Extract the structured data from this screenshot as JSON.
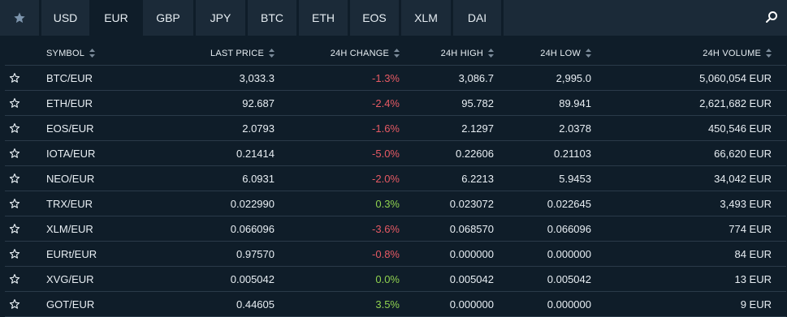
{
  "tabs": {
    "favorites_icon": "star-icon",
    "items": [
      "USD",
      "EUR",
      "GBP",
      "JPY",
      "BTC",
      "ETH",
      "EOS",
      "XLM",
      "DAI"
    ],
    "active": "EUR",
    "search_icon": "search-icon"
  },
  "table": {
    "headers": {
      "symbol": "SYMBOL",
      "last_price": "LAST PRICE",
      "change_24h": "24H CHANGE",
      "high_24h": "24H HIGH",
      "low_24h": "24H LOW",
      "volume_24h": "24H VOLUME"
    },
    "rows": [
      {
        "symbol": "BTC/EUR",
        "last": "3,033.3",
        "change": "-1.3%",
        "high": "3,086.7",
        "low": "2,995.0",
        "volume": "5,060,054 EUR"
      },
      {
        "symbol": "ETH/EUR",
        "last": "92.687",
        "change": "-2.4%",
        "high": "95.782",
        "low": "89.941",
        "volume": "2,621,682 EUR"
      },
      {
        "symbol": "EOS/EUR",
        "last": "2.0793",
        "change": "-1.6%",
        "high": "2.1297",
        "low": "2.0378",
        "volume": "450,546 EUR"
      },
      {
        "symbol": "IOTA/EUR",
        "last": "0.21414",
        "change": "-5.0%",
        "high": "0.22606",
        "low": "0.21103",
        "volume": "66,620 EUR"
      },
      {
        "symbol": "NEO/EUR",
        "last": "6.0931",
        "change": "-2.0%",
        "high": "6.2213",
        "low": "5.9453",
        "volume": "34,042 EUR"
      },
      {
        "symbol": "TRX/EUR",
        "last": "0.022990",
        "change": "0.3%",
        "high": "0.023072",
        "low": "0.022645",
        "volume": "3,493 EUR"
      },
      {
        "symbol": "XLM/EUR",
        "last": "0.066096",
        "change": "-3.6%",
        "high": "0.068570",
        "low": "0.066096",
        "volume": "774 EUR"
      },
      {
        "symbol": "EURt/EUR",
        "last": "0.97570",
        "change": "-0.8%",
        "high": "0.000000",
        "low": "0.000000",
        "volume": "84 EUR"
      },
      {
        "symbol": "XVG/EUR",
        "last": "0.005042",
        "change": "0.0%",
        "high": "0.005042",
        "low": "0.005042",
        "volume": "13 EUR"
      },
      {
        "symbol": "GOT/EUR",
        "last": "0.44605",
        "change": "3.5%",
        "high": "0.000000",
        "low": "0.000000",
        "volume": "9 EUR"
      }
    ]
  },
  "colors": {
    "negative": "#e75a64",
    "positive": "#8fd14f",
    "background": "#0f1d29",
    "tab_background": "#1b2a38"
  }
}
